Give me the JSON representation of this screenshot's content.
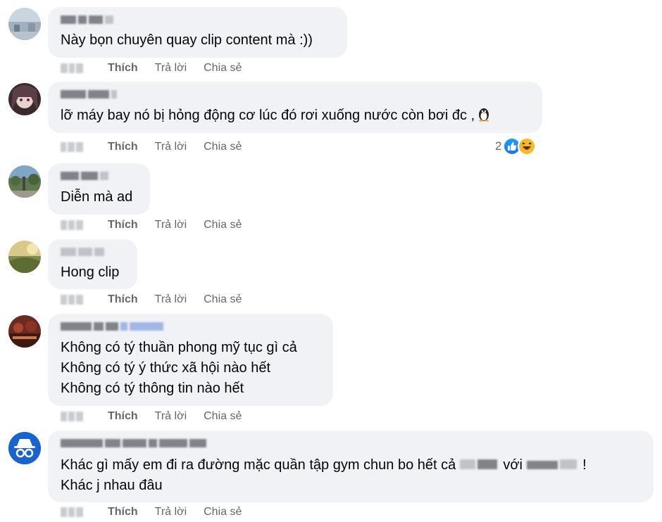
{
  "actions": {
    "like": "Thích",
    "reply": "Trả lời",
    "share": "Chia sẻ"
  },
  "comments": [
    {
      "lines": [
        "Này bọn chuyên quay clip content mà :))"
      ]
    },
    {
      "lines": [
        "lỡ máy bay nó bị hỏng động cơ lúc đó rơi xuống nước còn bơi đc ,"
      ],
      "reaction_count": "2",
      "reactions": [
        "like-icon",
        "haha-icon"
      ],
      "emoji": "penguin-icon"
    },
    {
      "lines": [
        "Diễn mà ad"
      ]
    },
    {
      "lines": [
        "Hong clip"
      ]
    },
    {
      "lines": [
        "Không có tý thuần phong mỹ tục gì cả",
        "Không có tý ý thức xã hội nào hết",
        "Không có tý thông tin nào hết"
      ]
    },
    {
      "lines": [
        "Khác gì mấy em đi ra đường mặc quần tập gym chun bo hết cả",
        "với",
        "!",
        "Khác j nhau đâu"
      ]
    }
  ],
  "colors": {
    "bubble": "#f0f2f5",
    "muted": "#65676b",
    "like_blue": "#1877f2",
    "anon_avatar": "#1763cf"
  }
}
